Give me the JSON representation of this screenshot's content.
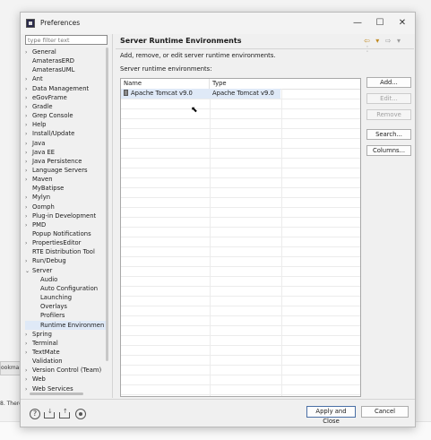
{
  "background": {
    "tab_label": "ookmar",
    "console_fragment": "8. There"
  },
  "window": {
    "title": "Preferences",
    "minimize_glyph": "—",
    "maximize_glyph": "☐",
    "close_glyph": "✕"
  },
  "filter": {
    "placeholder": "type filter text"
  },
  "tree": [
    {
      "label": "General",
      "chevron": "›",
      "indent": 0
    },
    {
      "label": "AmaterasERD",
      "chevron": "",
      "indent": 0
    },
    {
      "label": "AmaterasUML",
      "chevron": "",
      "indent": 0
    },
    {
      "label": "Ant",
      "chevron": "›",
      "indent": 0
    },
    {
      "label": "Data Management",
      "chevron": "›",
      "indent": 0
    },
    {
      "label": "eGovFrame",
      "chevron": "›",
      "indent": 0
    },
    {
      "label": "Gradle",
      "chevron": "›",
      "indent": 0
    },
    {
      "label": "Grep Console",
      "chevron": "›",
      "indent": 0
    },
    {
      "label": "Help",
      "chevron": "›",
      "indent": 0
    },
    {
      "label": "Install/Update",
      "chevron": "›",
      "indent": 0
    },
    {
      "label": "Java",
      "chevron": "›",
      "indent": 0
    },
    {
      "label": "Java EE",
      "chevron": "›",
      "indent": 0
    },
    {
      "label": "Java Persistence",
      "chevron": "›",
      "indent": 0
    },
    {
      "label": "Language Servers",
      "chevron": "›",
      "indent": 0
    },
    {
      "label": "Maven",
      "chevron": "›",
      "indent": 0
    },
    {
      "label": "MyBatipse",
      "chevron": "",
      "indent": 0
    },
    {
      "label": "Mylyn",
      "chevron": "›",
      "indent": 0
    },
    {
      "label": "Oomph",
      "chevron": "›",
      "indent": 0
    },
    {
      "label": "Plug-in Development",
      "chevron": "›",
      "indent": 0
    },
    {
      "label": "PMD",
      "chevron": "›",
      "indent": 0
    },
    {
      "label": "Popup Notifications",
      "chevron": "",
      "indent": 0
    },
    {
      "label": "PropertiesEditor",
      "chevron": "›",
      "indent": 0
    },
    {
      "label": "RTE Distribution Tool",
      "chevron": "",
      "indent": 0
    },
    {
      "label": "Run/Debug",
      "chevron": "›",
      "indent": 0
    },
    {
      "label": "Server",
      "chevron": "⌄",
      "indent": 0
    },
    {
      "label": "Audio",
      "chevron": "",
      "indent": 1
    },
    {
      "label": "Auto Configuration",
      "chevron": "",
      "indent": 1
    },
    {
      "label": "Launching",
      "chevron": "",
      "indent": 1
    },
    {
      "label": "Overlays",
      "chevron": "",
      "indent": 1
    },
    {
      "label": "Profilers",
      "chevron": "",
      "indent": 1
    },
    {
      "label": "Runtime Environmen",
      "chevron": "",
      "indent": 1,
      "selected": true
    },
    {
      "label": "Spring",
      "chevron": "›",
      "indent": 0
    },
    {
      "label": "Terminal",
      "chevron": "›",
      "indent": 0
    },
    {
      "label": "TextMate",
      "chevron": "›",
      "indent": 0
    },
    {
      "label": "Validation",
      "chevron": "",
      "indent": 0
    },
    {
      "label": "Version Control (Team)",
      "chevron": "›",
      "indent": 0
    },
    {
      "label": "Web",
      "chevron": "›",
      "indent": 0
    },
    {
      "label": "Web Services",
      "chevron": "›",
      "indent": 0
    }
  ],
  "page": {
    "title": "Server Runtime Environments",
    "description": "Add, remove, or edit server runtime environments.",
    "list_label": "Server runtime environments:",
    "nav_back": "⇦ ▾",
    "nav_forward": "⇨ ▾",
    "nav_menu": "⋮"
  },
  "table": {
    "headers": [
      "Name",
      "Type"
    ],
    "rows": [
      {
        "name": "Apache Tomcat v9.0",
        "type": "Apache Tomcat v9.0",
        "selected": true
      }
    ]
  },
  "buttons": {
    "add": "Add...",
    "edit": "Edit...",
    "remove": "Remove",
    "search": "Search...",
    "columns": "Columns..."
  },
  "footer": {
    "help_glyph": "?",
    "apply_close": "Apply and Close",
    "cancel": "Cancel"
  }
}
